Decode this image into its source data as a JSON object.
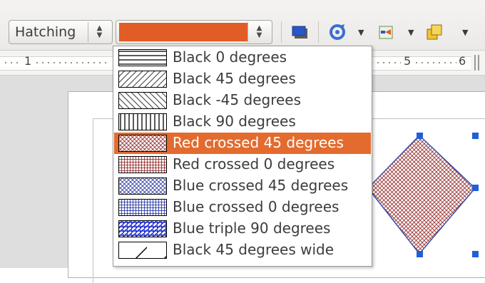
{
  "toolbar": {
    "area_style_value": "Hatching",
    "fill_color": "#e25c25",
    "icons": [
      "shadow-icon",
      "rotate-icon",
      "align-icon",
      "arrange-icon"
    ]
  },
  "ruler": {
    "labels": [
      "1",
      "5",
      "6"
    ]
  },
  "hatch_list": {
    "selected_index": 4,
    "items": [
      {
        "label": "Black 0 degrees",
        "line_color": "#000000",
        "pattern": "lines-0"
      },
      {
        "label": "Black 45 degrees",
        "line_color": "#000000",
        "pattern": "lines-45"
      },
      {
        "label": "Black -45 degrees",
        "line_color": "#000000",
        "pattern": "lines-neg45"
      },
      {
        "label": "Black 90 degrees",
        "line_color": "#000000",
        "pattern": "lines-90"
      },
      {
        "label": "Red crossed 45 degrees",
        "line_color": "#8b1a1a",
        "pattern": "cross-45"
      },
      {
        "label": "Red crossed 0 degrees",
        "line_color": "#8b1a1a",
        "pattern": "cross-0"
      },
      {
        "label": "Blue crossed 45 degrees",
        "line_color": "#1a2a9b",
        "pattern": "cross-45"
      },
      {
        "label": "Blue crossed 0 degrees",
        "line_color": "#1a2a9b",
        "pattern": "cross-0"
      },
      {
        "label": "Blue triple 90 degrees",
        "line_color": "#1a2ad0",
        "pattern": "triple-90"
      },
      {
        "label": "Black 45 degrees wide",
        "line_color": "#000000",
        "pattern": "wide-45"
      }
    ]
  },
  "shape": {
    "fill_pattern": "cross-45",
    "fill_color": "#8b1a1a",
    "handle_color": "#1f5fd8"
  }
}
